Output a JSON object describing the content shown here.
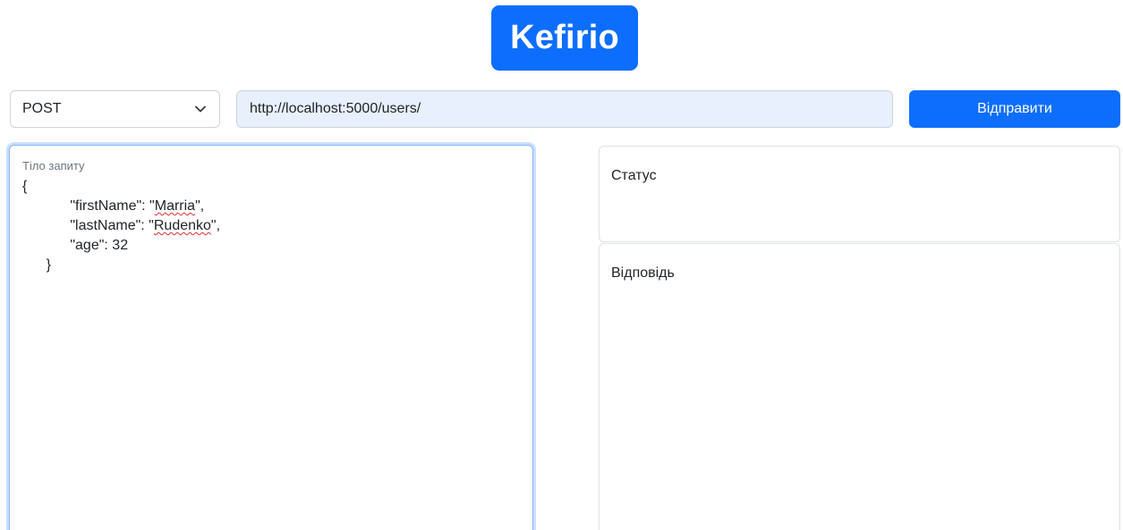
{
  "app": {
    "logo_text": "Kefirio"
  },
  "request": {
    "method": {
      "selected": "POST",
      "icon": "chevron-down-icon"
    },
    "url": "http://localhost:5000/users/",
    "send_label": "Відправити",
    "body": {
      "label": "Тіло запиту",
      "lines": [
        "{",
        "            \"firstName\": \"",
        "Marria",
        "\",",
        "            \"lastName\": \"",
        "Rudenko",
        "\",",
        "            \"age\": 32",
        "      }"
      ]
    }
  },
  "response": {
    "status_label": "Статус",
    "answer_label": "Відповідь"
  },
  "colors": {
    "accent": "#0d6efd",
    "url_background": "#e8f0fe",
    "border": "#ced4da"
  }
}
